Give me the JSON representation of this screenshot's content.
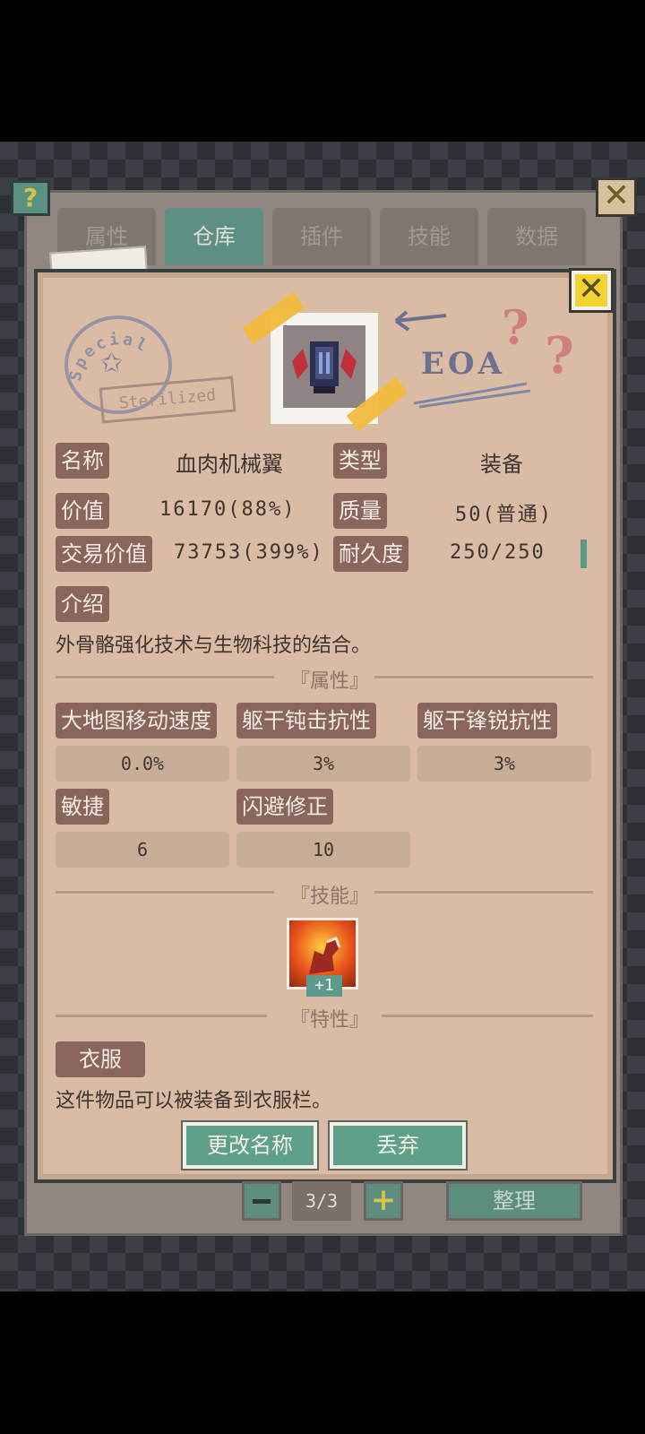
{
  "tabs": [
    {
      "label": "属性",
      "active": false
    },
    {
      "label": "仓库",
      "active": true
    },
    {
      "label": "插件",
      "active": false
    },
    {
      "label": "技能",
      "active": false
    },
    {
      "label": "数据",
      "active": false
    }
  ],
  "help_label": "?",
  "close_glyph": "✕",
  "stamp": {
    "text": "Special",
    "sterilized": "Sterilized"
  },
  "scribble": {
    "text": "EOA",
    "question": "?"
  },
  "info": {
    "name_label": "名称",
    "name_value": "血肉机械翼",
    "type_label": "类型",
    "type_value": "装备",
    "price_label": "价值",
    "price_value": "16170(88%)",
    "quality_label": "质量",
    "quality_value": "50(普通)",
    "trade_label": "交易价值",
    "trade_value": "73753(399%)",
    "durability_label": "耐久度",
    "durability_value": "250/250"
  },
  "intro": {
    "label": "介绍",
    "text": "外骨骼强化技术与生物科技的结合。"
  },
  "attributes": {
    "title": "『属性』",
    "items": [
      {
        "label": "大地图移动速度",
        "value": "0.0%"
      },
      {
        "label": "躯干钝击抗性",
        "value": "3%"
      },
      {
        "label": "躯干锋锐抗性",
        "value": "3%"
      },
      {
        "label": "敏捷",
        "value": "6"
      },
      {
        "label": "闪避修正",
        "value": "10"
      }
    ]
  },
  "skills": {
    "title": "『技能』",
    "badge": "+1",
    "icon": "flame-claw-icon"
  },
  "traits": {
    "title": "『特性』",
    "label": "衣服",
    "text": "这件物品可以被装备到衣服栏。"
  },
  "buttons": {
    "rename": "更改名称",
    "discard": "丢弃"
  },
  "pager": {
    "page": "3/3",
    "plus": "+",
    "sort": "整理"
  },
  "colors": {
    "card": "#d9bca3",
    "label_bg": "#89655b",
    "accent": "#5fa08b",
    "close_yellow": "#f3d333"
  }
}
